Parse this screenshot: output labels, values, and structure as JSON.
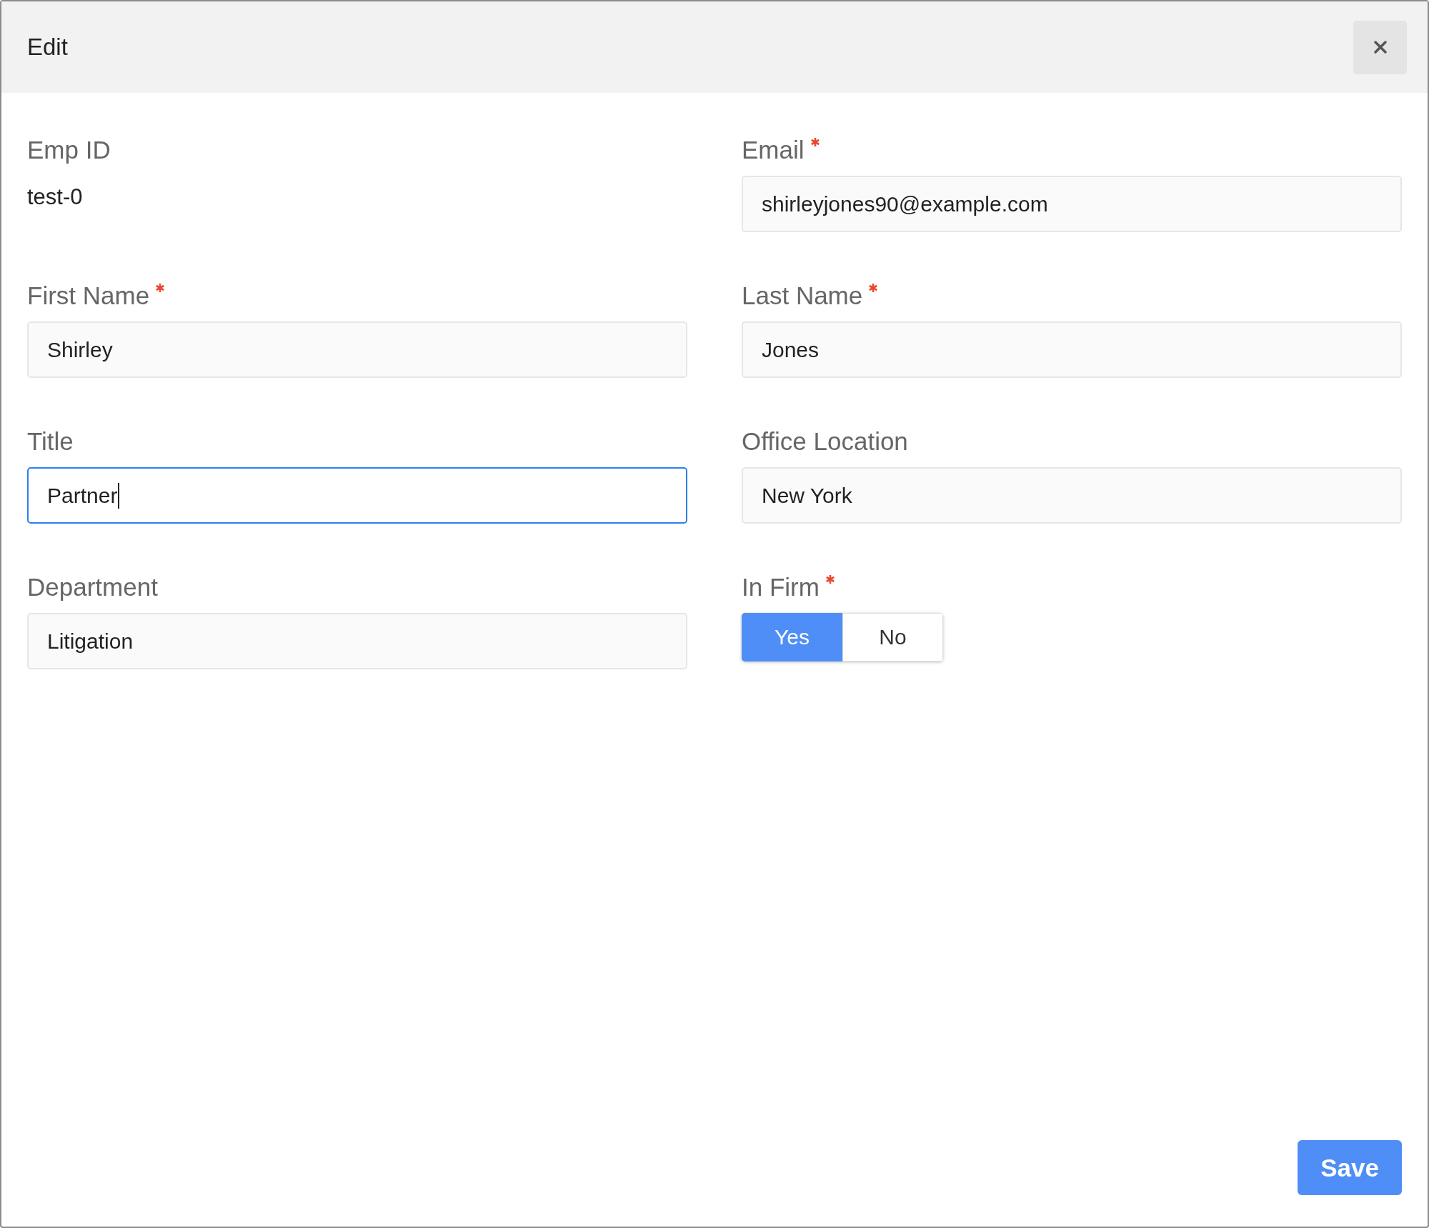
{
  "dialog": {
    "title": "Edit"
  },
  "fields": [
    {
      "kind": "text",
      "label": "Emp ID",
      "required": false,
      "value": "test-0"
    },
    {
      "kind": "input",
      "label": "Email",
      "required": true,
      "value": "shirleyjones90@example.com",
      "focused": false
    },
    {
      "kind": "input",
      "label": "First Name",
      "required": true,
      "value": "Shirley",
      "focused": false
    },
    {
      "kind": "input",
      "label": "Last Name",
      "required": true,
      "value": "Jones",
      "focused": false
    },
    {
      "kind": "input",
      "label": "Title",
      "required": false,
      "value": "Partner",
      "focused": true
    },
    {
      "kind": "input",
      "label": "Office Location",
      "required": false,
      "value": "New York",
      "focused": false
    },
    {
      "kind": "input",
      "label": "Department",
      "required": false,
      "value": "Litigation",
      "focused": false
    },
    {
      "kind": "toggle",
      "label": "In Firm",
      "required": true,
      "options": [
        {
          "label": "Yes",
          "selected": true
        },
        {
          "label": "No",
          "selected": false
        }
      ]
    }
  ],
  "buttons": [
    {
      "label": "Save"
    }
  ]
}
